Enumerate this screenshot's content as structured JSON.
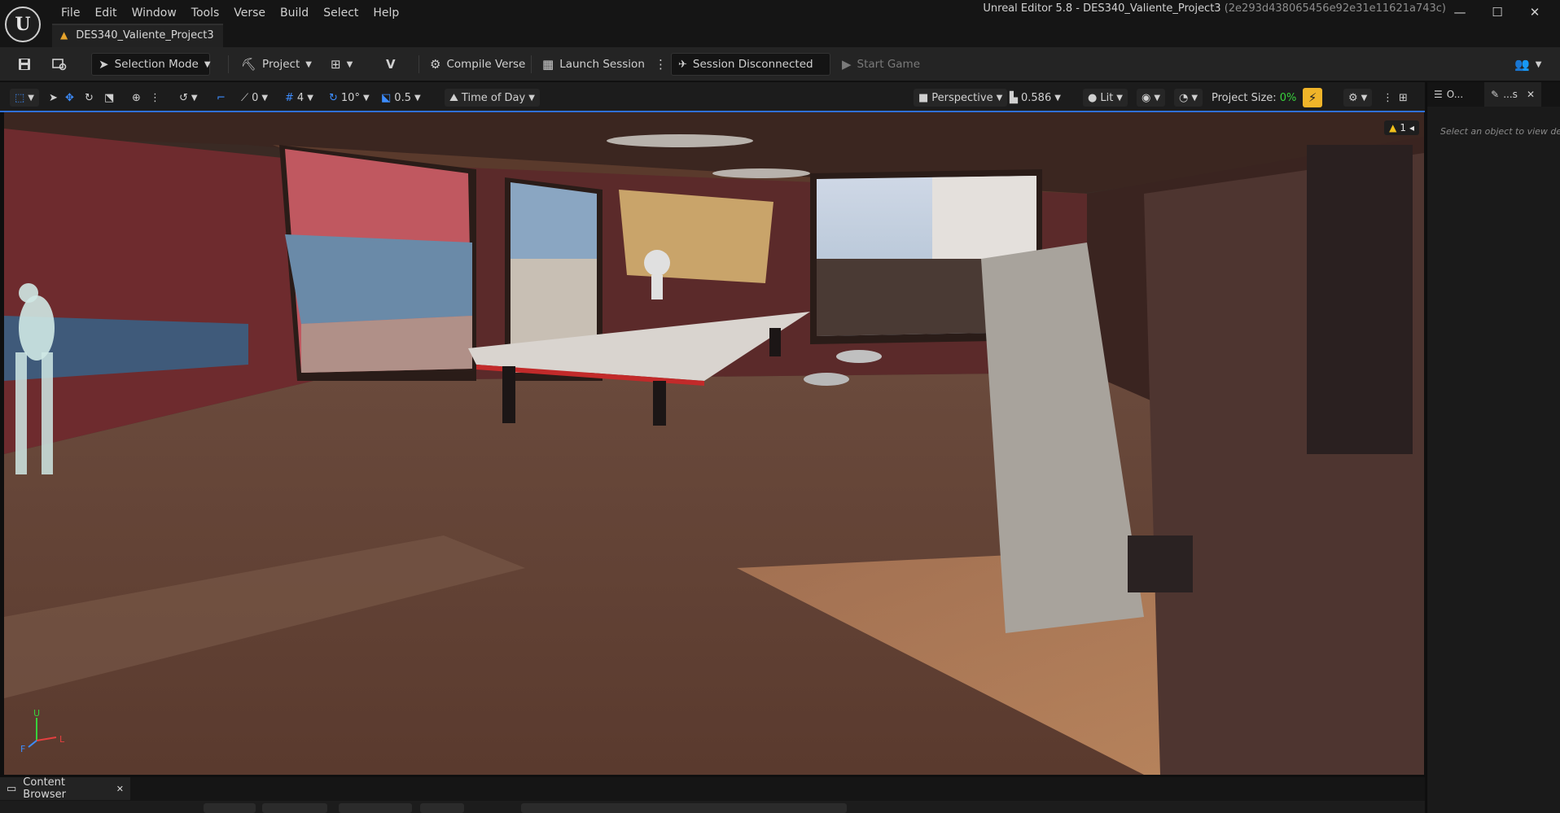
{
  "app": {
    "logo": "U",
    "title": "Unreal Editor 5.8 - DES340_Valiente_Project3",
    "title_hash": "(2e293d438065456e92e31e11621a743c)"
  },
  "menu": [
    "File",
    "Edit",
    "Window",
    "Tools",
    "Verse",
    "Build",
    "Select",
    "Help"
  ],
  "window_controls": {
    "minimize": "—",
    "maximize": "☐",
    "close": "✕"
  },
  "project_tab": {
    "label": "DES340_Valiente_Project3",
    "icon": "warning-icon"
  },
  "toolbar": {
    "selection_mode": "Selection Mode",
    "project": "Project",
    "compile_verse": "Compile Verse",
    "launch_session": "Launch Session",
    "session_status": "Session Disconnected",
    "start_game": "Start Game"
  },
  "viewport_toolbar": {
    "rotation_snap_value": "0",
    "grid_snap_value": "4",
    "angle_snap_value": "10°",
    "scale_snap_value": "0.5",
    "time_of_day": "Time of Day",
    "perspective": "Perspective",
    "camera_speed": "0.586",
    "view_mode": "Lit",
    "project_size_label": "Project Size:",
    "project_size_value": "0%"
  },
  "viewport": {
    "warning_count": "1",
    "axis_labels": {
      "up": "U",
      "forward": "F",
      "left": "L"
    }
  },
  "details_panel": {
    "tab1": "O...",
    "tab2": "...s",
    "hint": "Select an object to view det"
  },
  "bottom_panel": {
    "tab_label": "Content Browser",
    "close": "✕"
  },
  "colors": {
    "accent_blue": "#2f6fd6",
    "warning_yellow": "#f2c21b",
    "project_size_green": "#38d23c",
    "realtime_orange": "#f0b429"
  }
}
